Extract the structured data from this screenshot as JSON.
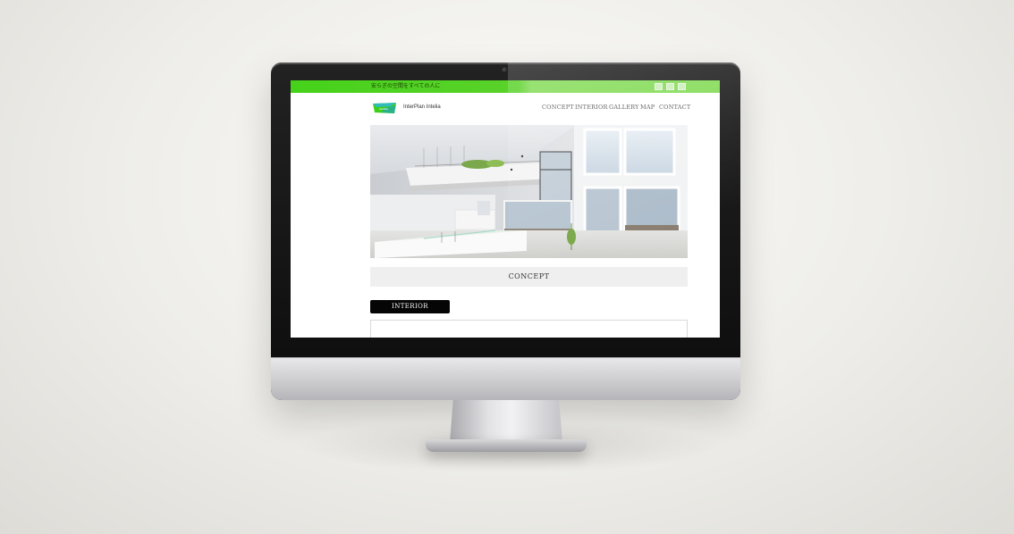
{
  "site": {
    "tagline": "安らぎの空間をすべての人に",
    "brand": "InterPlan Intelia",
    "logo_text": "InterPlan",
    "colors": {
      "accent": "#46d21a",
      "accent_light": "#86dc5a",
      "badge": "#050505"
    }
  },
  "nav": {
    "items": [
      "CONCEPT",
      "INTERIOR",
      "GALLERY",
      "MAP",
      "CONTACT"
    ]
  },
  "sections": {
    "concept_label": "CONCEPT",
    "interior_label": "INTERIOR"
  },
  "hero": {
    "icon": "interior-photo"
  }
}
